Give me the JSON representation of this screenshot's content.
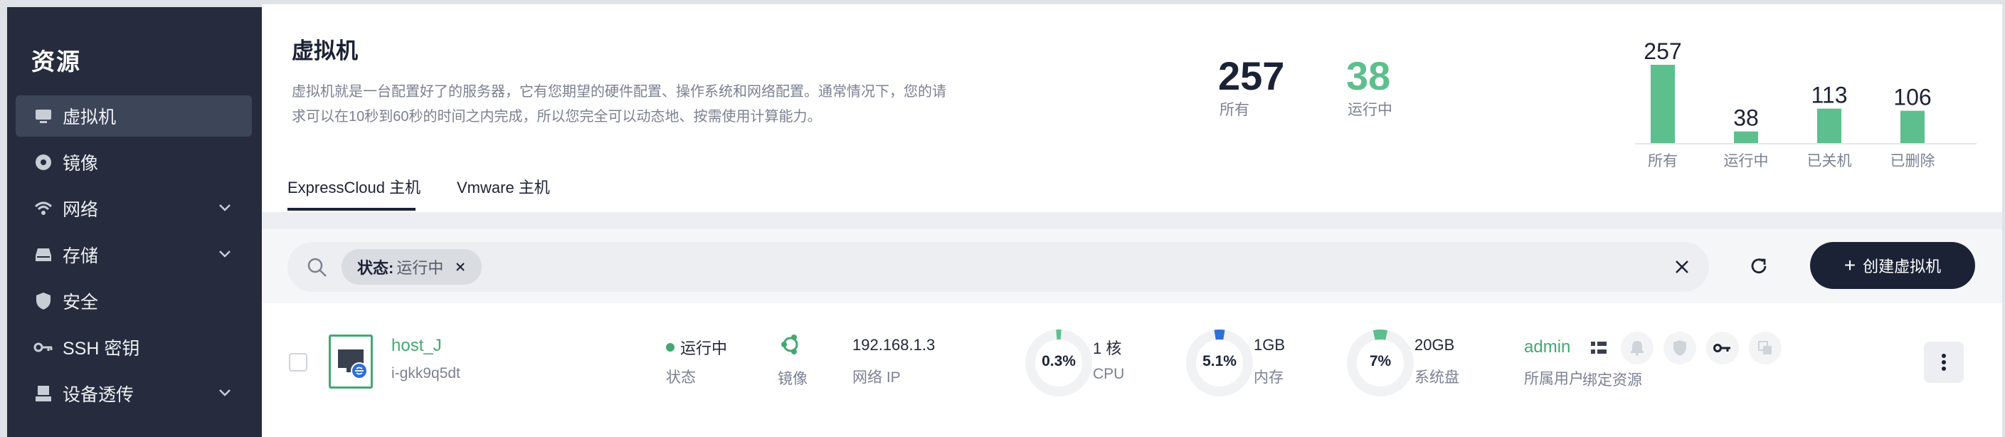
{
  "sidebar": {
    "title": "资源",
    "items": [
      {
        "label": "虚拟机",
        "icon": "monitor-icon",
        "active": true
      },
      {
        "label": "镜像",
        "icon": "disc-icon"
      },
      {
        "label": "网络",
        "icon": "wifi-icon",
        "expandable": true
      },
      {
        "label": "存储",
        "icon": "drive-icon",
        "expandable": true
      },
      {
        "label": "安全",
        "icon": "shield-icon"
      },
      {
        "label": "SSH 密钥",
        "icon": "key-icon"
      },
      {
        "label": "设备透传",
        "icon": "device-icon",
        "expandable": true
      }
    ]
  },
  "header": {
    "title": "虚拟机",
    "description_line1": "虚拟机就是一台配置好了的服务器，它有您期望的硬件配置、操作系统和网络配置。通常情况下，您的请",
    "description_line2": "求可以在10秒到60秒的时间之内完成，所以您完全可以动态地、按需使用计算能力。",
    "stats": [
      {
        "value": "257",
        "label": "所有"
      },
      {
        "value": "38",
        "label": "运行中"
      }
    ]
  },
  "chart_data": {
    "type": "bar",
    "categories": [
      "所有",
      "运行中",
      "已关机",
      "已删除"
    ],
    "values": [
      257,
      38,
      113,
      106
    ],
    "title": "",
    "xlabel": "",
    "ylabel": "",
    "ylim": [
      0,
      257
    ],
    "color": "#5cbf8d"
  },
  "tabs": [
    {
      "label": "ExpressCloud 主机",
      "active": true
    },
    {
      "label": "Vmware 主机"
    }
  ],
  "filter": {
    "chip_key": "状态:",
    "chip_value": "运行中",
    "create_label": "创建虚拟机"
  },
  "vm": {
    "name": "host_J",
    "id": "i-gkk9q5dt",
    "status": "运行中",
    "status_label": "状态",
    "image_label": "镜像",
    "ip": "192.168.1.3",
    "ip_label": "网络 IP",
    "cpu_pct": "0.3%",
    "cpu_pct_value": 0.3,
    "cpu_value": "1 核",
    "cpu_label": "CPU",
    "mem_pct": "5.1%",
    "mem_pct_value": 5.1,
    "mem_value": "1GB",
    "mem_label": "内存",
    "disk_pct": "7%",
    "disk_pct_value": 7,
    "disk_value": "20GB",
    "disk_label": "系统盘",
    "owner": "admin",
    "owner_label": "所属用户",
    "bind_label": "绑定资源"
  },
  "colors": {
    "accent_green": "#43a872",
    "dark": "#1c2236",
    "cpu_ring": "#5cbf8d",
    "mem_ring": "#2f6fd1",
    "disk_ring": "#5cbf8d"
  }
}
